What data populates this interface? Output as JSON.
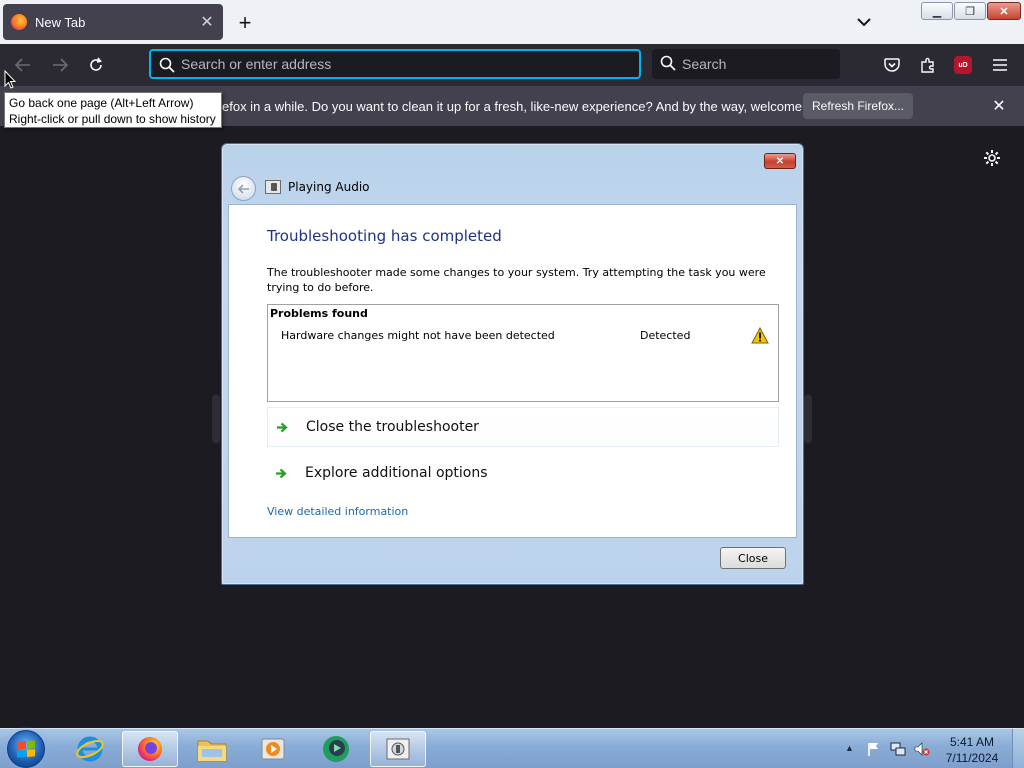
{
  "browser": {
    "tab": {
      "title": "New Tab"
    },
    "urlbar": {
      "placeholder": "Search or enter address"
    },
    "searchbar": {
      "placeholder": "Search"
    },
    "ublock_label": "uD"
  },
  "notification": {
    "text": "efox in a while. Do you want to clean it up for a fresh, like-new experience? And by the way, welcome back!",
    "button": "Refresh Firefox..."
  },
  "tooltip": {
    "line1": "Go back one page (Alt+Left Arrow)",
    "line2": "Right-click or pull down to show history"
  },
  "dialog": {
    "title": "Playing Audio",
    "heading": "Troubleshooting has completed",
    "description": "The troubleshooter made some changes to your system. Try attempting the task you were trying to do before.",
    "problems_header": "Problems found",
    "problems": [
      {
        "name": "Hardware changes might not have been detected",
        "status": "Detected"
      }
    ],
    "options": [
      {
        "label": "Close the troubleshooter"
      },
      {
        "label": "Explore additional options"
      }
    ],
    "detail_link": "View detailed information",
    "close_button": "Close"
  },
  "taskbar": {
    "time": "5:41 AM",
    "date": "7/11/2024"
  },
  "colors": {
    "accent": "#00b3f4",
    "dialog_heading": "#1e3287",
    "link": "#1e66b4"
  }
}
